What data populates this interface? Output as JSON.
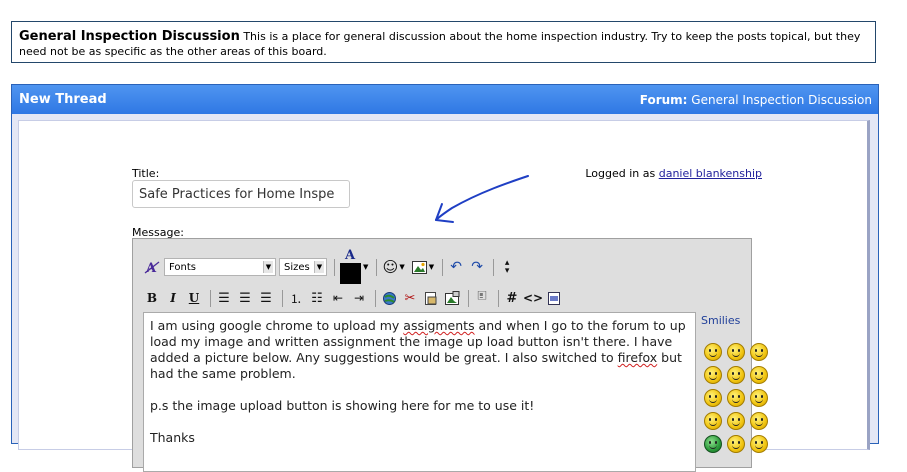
{
  "forum_description": {
    "name": "General Inspection Discussion",
    "text": " This is a place for general discussion about the home inspection industry. Try to keep the posts topical, but they need not be as specific as the other areas of this board."
  },
  "panel": {
    "title": "New Thread",
    "crumb_label": "Forum:",
    "crumb_value": " General Inspection Discussion"
  },
  "form": {
    "title_label": "Title:",
    "title_value": "Safe Practices for Home Inspe",
    "logged_prefix": "Logged in as ",
    "logged_user": "daniel blankenship",
    "message_label": "Message:"
  },
  "toolbar": {
    "fonts": "Fonts",
    "sizes": "Sizes",
    "font_color": "A",
    "bold": "B",
    "italic": "I",
    "underline": "U",
    "hash": "#",
    "code": "<>"
  },
  "message": {
    "line1_a": "I am using google chrome to upload my ",
    "line1_spell": "assigments",
    "line1_b": " and when I go to the forum to up load my image and written assignment the image up load button isn't there. I have added a picture below. Any suggestions would be great. I also switched to ",
    "line1_spell2": "firefox",
    "line1_c": " but had the same problem.",
    "line2": "p.s the image upload button is showing here for me to use it!",
    "line3": "Thanks"
  },
  "smilies": {
    "label": "Smilies"
  },
  "colors": {
    "header_blue": "#3b83ea",
    "panel_bg": "#e4e7f5",
    "arrow": "#1f3fc4"
  }
}
